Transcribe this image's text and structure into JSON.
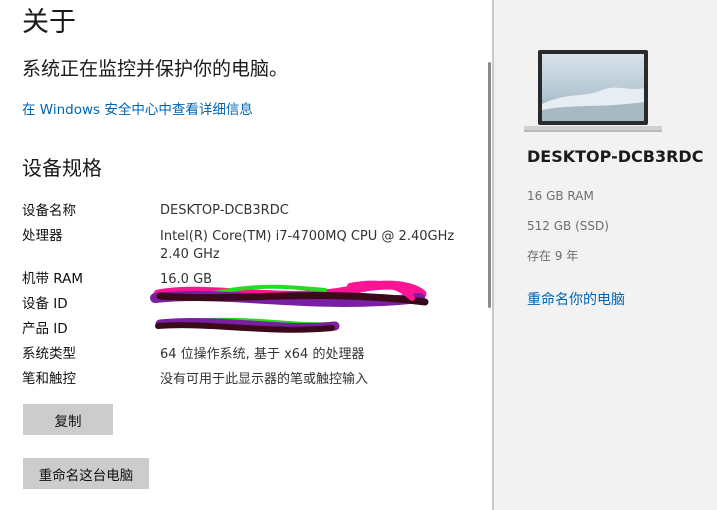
{
  "about": {
    "title": "关于",
    "protection_status": "系统正在监控并保护你的电脑。",
    "security_link": "在 Windows 安全中心中查看详细信息"
  },
  "specs": {
    "heading": "设备规格",
    "rows": [
      {
        "label": "设备名称",
        "value": "DESKTOP-DCB3RDC"
      },
      {
        "label": "处理器",
        "value": "Intel(R) Core(TM) i7-4700MQ CPU @ 2.40GHz",
        "value2": "2.40 GHz"
      },
      {
        "label": "机带 RAM",
        "value": "16.0 GB"
      },
      {
        "label": "设备 ID",
        "value": ""
      },
      {
        "label": "产品 ID",
        "value": ""
      },
      {
        "label": "系统类型",
        "value": "64 位操作系统, 基于 x64 的处理器"
      },
      {
        "label": "笔和触控",
        "value": "没有可用于此显示器的笔或触控输入"
      }
    ],
    "copy_button": "复制",
    "rename_button": "重命名这台电脑"
  },
  "sidebar": {
    "pc_name": "DESKTOP-DCB3RDC",
    "ram": "16 GB RAM",
    "storage": "512 GB (SSD)",
    "age": "存在 9 年",
    "rename_link": "重命名你的电脑"
  },
  "colors": {
    "accent_link": "#0064b4",
    "button_bg": "#cccccc",
    "sidebar_bg": "#f2f2f2"
  }
}
